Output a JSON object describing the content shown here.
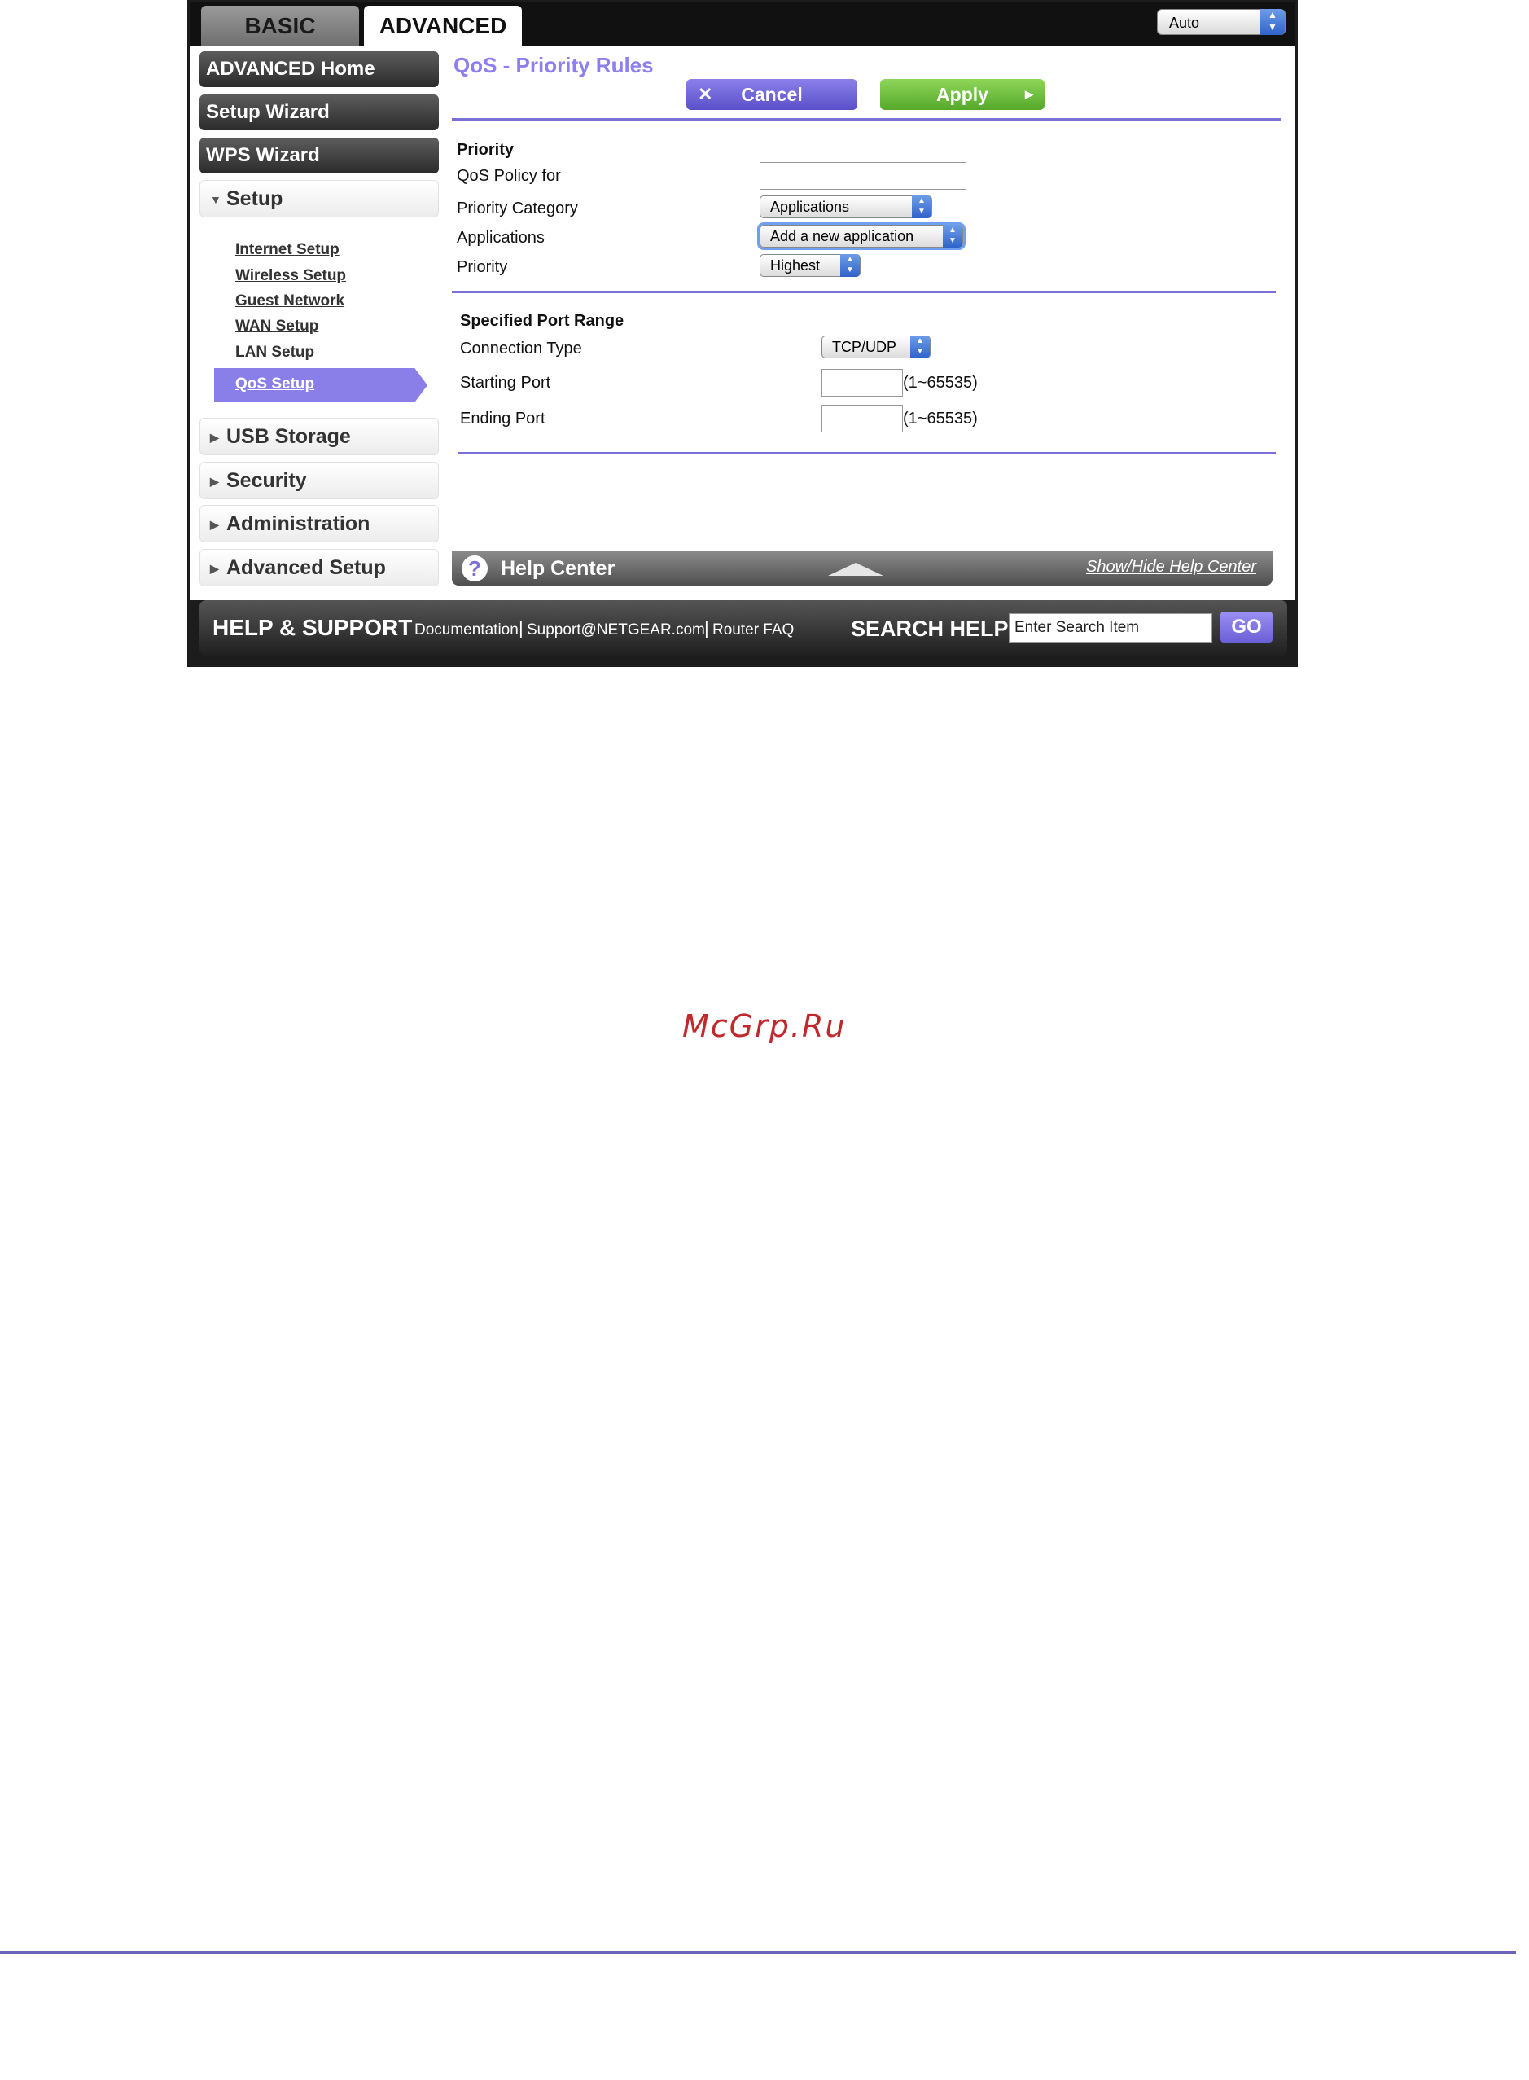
{
  "tabs": {
    "basic": "BASIC",
    "advanced": "ADVANCED"
  },
  "language_select": {
    "value": "Auto"
  },
  "nav": {
    "buttons": [
      "ADVANCED Home",
      "Setup Wizard",
      "WPS Wizard"
    ],
    "setup": {
      "label": "Setup",
      "links": [
        "Internet Setup",
        "Wireless Setup",
        "Guest Network",
        "WAN Setup",
        "LAN Setup"
      ],
      "active": "QoS Setup"
    },
    "sections": [
      "USB Storage",
      "Security",
      "Administration",
      "Advanced Setup"
    ]
  },
  "page": {
    "title": "QoS - Priority Rules",
    "cancel_label": "Cancel",
    "apply_label": "Apply",
    "priority_heading": "Priority",
    "qos_policy_label": "QoS Policy for",
    "qos_policy_value": "",
    "priority_category_label": "Priority Category",
    "priority_category_value": "Applications",
    "applications_label": "Applications",
    "applications_value": "Add a new application",
    "priority_label": "Priority",
    "priority_value": "Highest",
    "port_range_heading": "Specified Port Range",
    "connection_type_label": "Connection Type",
    "connection_type_value": "TCP/UDP",
    "starting_port_label": "Starting Port",
    "starting_port_range": "(1~65535)",
    "ending_port_label": "Ending Port",
    "ending_port_range": "(1~65535)"
  },
  "help_center": {
    "title": "Help Center",
    "toggle": "Show/Hide Help Center"
  },
  "support": {
    "title": "HELP & SUPPORT",
    "links": [
      "Documentation",
      "Support@NETGEAR.com",
      "Router FAQ"
    ],
    "search_title": "SEARCH HELP",
    "search_placeholder": "Enter Search Item",
    "go": "GO"
  },
  "watermark": "McGrp.Ru",
  "colors": {
    "accent": "#8c7ff0",
    "apply_green": "#6cbf3c",
    "watermark": "#c0282e"
  }
}
